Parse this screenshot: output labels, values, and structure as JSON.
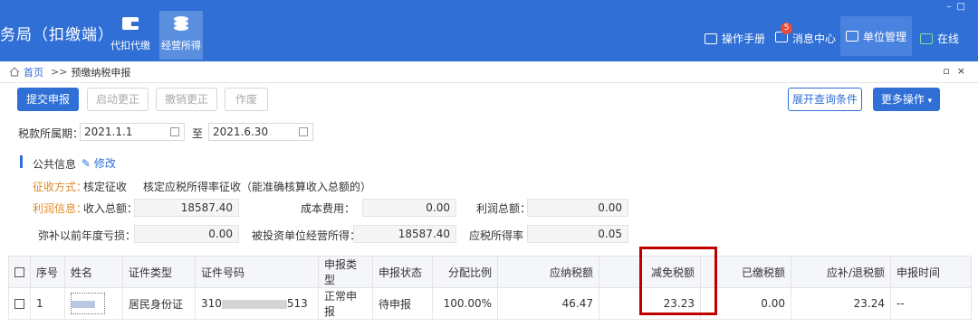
{
  "header": {
    "app_title": "务局（扣缴端）",
    "window_controls": [
      "–",
      "□"
    ],
    "modules": [
      {
        "label": "代扣代缴",
        "icon": "wallet-icon"
      },
      {
        "label": "经营所得",
        "icon": "coins-icon",
        "active": true
      }
    ],
    "nav": [
      {
        "label": "操作手册",
        "icon": "book-icon"
      },
      {
        "label": "消息中心",
        "icon": "mail-icon",
        "badge": "5"
      },
      {
        "label": "单位管理",
        "icon": "building-icon",
        "active": true
      },
      {
        "label": "在线",
        "icon": "chat-icon"
      }
    ]
  },
  "breadcrumb": {
    "home": "首页",
    "sep": ">>",
    "current": "预缴纳税申报",
    "controls": [
      "▫",
      "×"
    ]
  },
  "toolbar": {
    "submit": "提交申报",
    "enable_correct": "启动更正",
    "cancel_correct": "撤销更正",
    "void": "作废",
    "expand_query": "展开查询条件",
    "more": "更多操作"
  },
  "period": {
    "label": "税款所属期：",
    "start": "2021.1.1",
    "to": "至",
    "end": "2021.6.30"
  },
  "public_info": {
    "title": "公共信息",
    "edit": "修改",
    "collect_method_label": "征收方式：",
    "collect_method_value": "核定征收",
    "collect_method_detail": "核定应税所得率征收（能准确核算收入总额的）",
    "profit_info_label": "利润信息：",
    "income_label": "收入总额：",
    "income_value": "18587.40",
    "cost_label": "成本费用：",
    "cost_value": "0.00",
    "profit_label": "利润总额：",
    "profit_value": "0.00",
    "loss_label": "弥补以前年度亏损：",
    "loss_value": "0.00",
    "invest_label": "被投资单位经营所得：",
    "invest_value": "18587.40",
    "rate_label": "应税所得率",
    "rate_value": "0.05"
  },
  "table": {
    "headers": [
      "序号",
      "姓名",
      "证件类型",
      "证件号码",
      "申报类型",
      "申报状态",
      "分配比例",
      "应纳税额",
      "减免税额",
      "已缴税额",
      "应补/退税额",
      "申报时间"
    ],
    "rows": [
      {
        "seq": "1",
        "id_type": "居民身份证",
        "id_prefix": "310",
        "id_suffix": "513",
        "decl_type": "正常申报",
        "status": "待申报",
        "ratio": "100.00%",
        "tax_due": "46.47",
        "tax_relief": "23.23",
        "tax_paid": "0.00",
        "tax_refund": "23.24",
        "decl_time": "--"
      }
    ]
  }
}
